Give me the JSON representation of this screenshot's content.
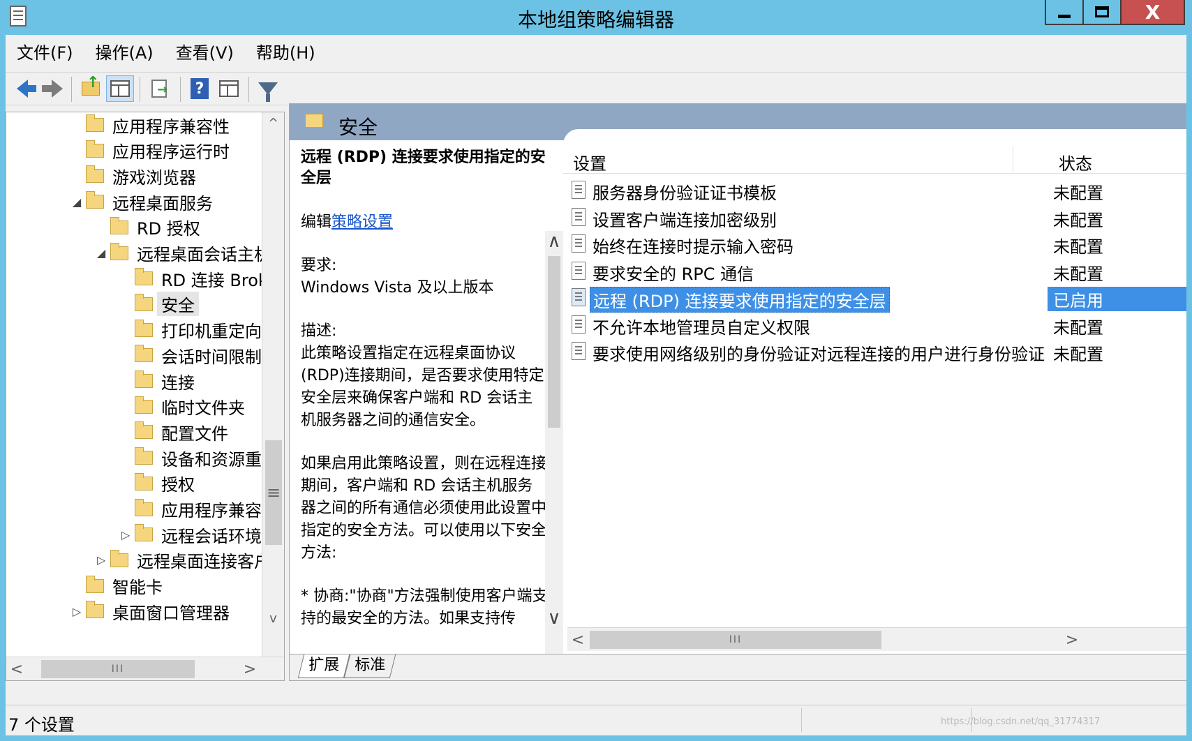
{
  "window": {
    "title": "本地组策略编辑器",
    "close_glyph": "X"
  },
  "menu": [
    "文件(F)",
    "操作(A)",
    "查看(V)",
    "帮助(H)"
  ],
  "toolbar": {
    "help_glyph": "?"
  },
  "tree": {
    "items": [
      {
        "label": "应用程序兼容性",
        "expander": ""
      },
      {
        "label": "应用程序运行时",
        "expander": ""
      },
      {
        "label": "游戏浏览器",
        "expander": ""
      },
      {
        "label": "远程桌面服务",
        "expander": "◢"
      },
      {
        "label": "RD 授权",
        "expander": ""
      },
      {
        "label": "远程桌面会话主机",
        "expander": "◢"
      },
      {
        "label": "RD 连接 Brok",
        "expander": ""
      },
      {
        "label": "安全",
        "expander": ""
      },
      {
        "label": "打印机重定向",
        "expander": ""
      },
      {
        "label": "会话时间限制",
        "expander": ""
      },
      {
        "label": "连接",
        "expander": ""
      },
      {
        "label": "临时文件夹",
        "expander": ""
      },
      {
        "label": "配置文件",
        "expander": ""
      },
      {
        "label": "设备和资源重定",
        "expander": ""
      },
      {
        "label": "授权",
        "expander": ""
      },
      {
        "label": "应用程序兼容性",
        "expander": ""
      },
      {
        "label": "远程会话环境",
        "expander": "▷"
      },
      {
        "label": "远程桌面连接客户",
        "expander": "▷"
      },
      {
        "label": "智能卡",
        "expander": ""
      },
      {
        "label": "桌面窗口管理器",
        "expander": "▷"
      }
    ],
    "scroll_up": "^",
    "scroll_down": "v",
    "scroll_grip": "≡",
    "hscroll_left": "<",
    "hscroll_right": ">",
    "hscroll_grip": "III"
  },
  "detail": {
    "header_title": "安全",
    "policy_title": "远程 (RDP) 连接要求使用指定的安全层",
    "edit_prefix": "编辑",
    "edit_link": "策略设置",
    "requirement_label": "要求:",
    "requirement_value": "Windows Vista 及以上版本",
    "description_label": "描述:",
    "description_p1": "此策略设置指定在远程桌面协议(RDP)连接期间，是否要求使用特定安全层来确保客户端和 RD 会话主机服务器之间的通信安全。",
    "description_p2": "如果启用此策略设置，则在远程连接期间，客户端和 RD 会话主机服务器之间的所有通信必须使用此设置中指定的安全方法。可以使用以下安全方法:",
    "description_p3": "* 协商:\"协商\"方法强制使用客户端支持的最安全的方法。如果支持传",
    "scroll_up": "∧",
    "scroll_down": "∨"
  },
  "list": {
    "col_setting": "设置",
    "col_state": "状态",
    "rows": [
      {
        "name": "服务器身份验证证书模板",
        "state": "未配置"
      },
      {
        "name": "设置客户端连接加密级别",
        "state": "未配置"
      },
      {
        "name": "始终在连接时提示输入密码",
        "state": "未配置"
      },
      {
        "name": "要求安全的 RPC 通信",
        "state": "未配置"
      },
      {
        "name": "远程 (RDP) 连接要求使用指定的安全层",
        "state": "已启用"
      },
      {
        "name": "不允许本地管理员自定义权限",
        "state": "未配置"
      },
      {
        "name": "要求使用网络级别的身份验证对远程连接的用户进行身份验证",
        "state": "未配置"
      }
    ],
    "selected_index": 4,
    "hscroll_left": "<",
    "hscroll_right": ">",
    "hscroll_grip": "III"
  },
  "tabs": [
    "扩展",
    "标准"
  ],
  "status": {
    "text": "7 个设置",
    "watermark": "https://blog.csdn.net/qq_31774317"
  }
}
